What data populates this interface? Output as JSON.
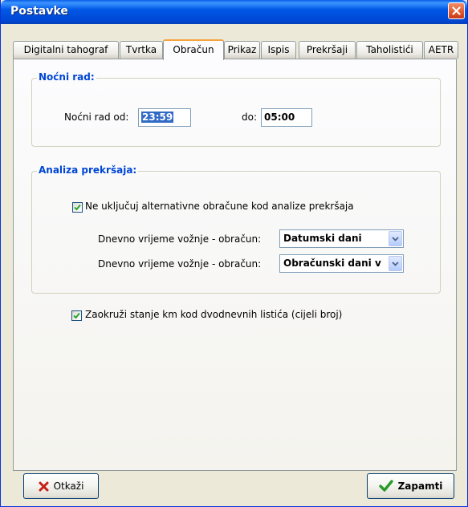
{
  "window": {
    "title": "Postavke"
  },
  "tabs": [
    {
      "label": "Digitalni tahograf",
      "active": false
    },
    {
      "label": "Tvrtka",
      "active": false
    },
    {
      "label": "Obračun",
      "active": true
    },
    {
      "label": "Prikaz",
      "active": false
    },
    {
      "label": "Ispis",
      "active": false
    },
    {
      "label": "Prekršaji",
      "active": false
    },
    {
      "label": "Taholistići",
      "active": false
    },
    {
      "label": "AETR",
      "active": false
    }
  ],
  "night_work": {
    "title": "Noćni rad:",
    "from_label": "Noćni rad od:",
    "from_value": "23:59",
    "to_label": "do:",
    "to_value": "05:00"
  },
  "violations": {
    "title": "Analiza prekršaja:",
    "exclude_checkbox": {
      "label": "Ne uključuj alternativne obračune kod analize prekršaja",
      "checked": true
    },
    "row1": {
      "label": "Dnevno vrijeme vožnje - obračun:",
      "value": "Datumski dani"
    },
    "row2": {
      "label": "Dnevno vrijeme vožnje - obračun:",
      "value": "Obračunski dani v"
    }
  },
  "round_checkbox": {
    "label": "Zaokruži stanje km kod dvodnevnih listića (cijeli broj)",
    "checked": true
  },
  "buttons": {
    "cancel": "Otkaži",
    "save": "Zapamti"
  },
  "colors": {
    "titlebar": "#0058e6",
    "group_title": "#0046d5",
    "tab_active_accent": "#f4a43e"
  },
  "icons": {
    "close": "close-icon",
    "cancel": "red-x-icon",
    "save": "green-check-icon",
    "dropdown": "chevron-down-icon",
    "check": "check-icon"
  }
}
